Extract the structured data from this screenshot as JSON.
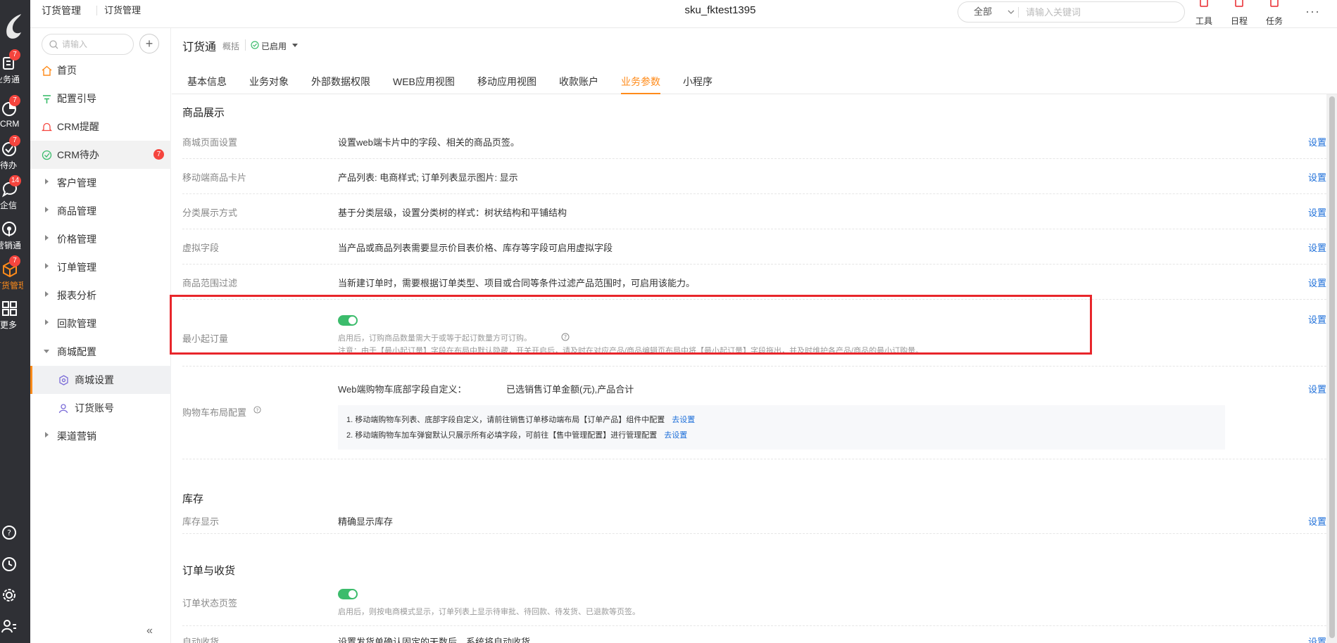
{
  "rail": {
    "items": [
      {
        "label": "业务通",
        "badge": "7"
      },
      {
        "label": "CRM",
        "badge": "7"
      },
      {
        "label": "待办",
        "badge": "7"
      },
      {
        "label": "企信",
        "badge": "14"
      },
      {
        "label": "营销通",
        "badge": ""
      },
      {
        "label": "订货管理",
        "badge": "7"
      },
      {
        "label": "更多",
        "badge": ""
      }
    ]
  },
  "header": {
    "breadcrumb_1": "订货管理",
    "breadcrumb_2": "订货管理",
    "title": "sku_fktest1395",
    "search_scope": "全部",
    "search_placeholder": "请输入关键词",
    "tools": [
      "工具",
      "日程",
      "任务"
    ],
    "more": "···"
  },
  "nav": {
    "search_placeholder": "请输入",
    "add": "+",
    "items": [
      {
        "label": "首页"
      },
      {
        "label": "配置引导"
      },
      {
        "label": "CRM提醒"
      },
      {
        "label": "CRM待办",
        "badge": "7"
      },
      {
        "label": "客户管理"
      },
      {
        "label": "商品管理"
      },
      {
        "label": "价格管理"
      },
      {
        "label": "订单管理"
      },
      {
        "label": "报表分析"
      },
      {
        "label": "回款管理"
      },
      {
        "label": "商城配置"
      },
      {
        "label": "商城设置"
      },
      {
        "label": "订货账号"
      },
      {
        "label": "渠道营销"
      }
    ],
    "collapse": "«"
  },
  "main": {
    "app_name": "订货通",
    "app_tag": "概括",
    "status": "已启用",
    "tabs": [
      "基本信息",
      "业务对象",
      "外部数据权限",
      "WEB应用视图",
      "移动应用视图",
      "收款账户",
      "业务参数",
      "小程序"
    ],
    "active_tab": "业务参数",
    "set_label": "设置",
    "sections": {
      "product": "商品展示",
      "stock": "库存",
      "order": "订单与收货"
    },
    "rows": {
      "r1": {
        "label": "商城页面设置",
        "desc": "设置web端卡片中的字段、相关的商品页签。"
      },
      "r2": {
        "label": "移动端商品卡片",
        "desc": "产品列表: 电商样式; 订单列表显示图片: 显示"
      },
      "r3": {
        "label": "分类展示方式",
        "desc": "基于分类层级，设置分类树的样式：树状结构和平铺结构"
      },
      "r4": {
        "label": "虚拟字段",
        "desc": "当产品或商品列表需要显示价目表价格、库存等字段可启用虚拟字段"
      },
      "r5": {
        "label": "商品范围过滤",
        "desc": "当新建订单时，需要根据订单类型、项目或合同等条件过滤产品范围时，可启用该能力。"
      },
      "r6": {
        "label": "最小起订量",
        "hint1": "启用后，订购商品数量需大于或等于起订数量方可订购。",
        "hint2": "注意：由于【最小起订量】字段在布局中默认隐藏，开关开启后，请及时在对应产品/商品编辑页布局中将【最小起订量】字段拖出，并及时维护各产品/商品的最小订购量。"
      },
      "r7": {
        "label": "购物车布局配置",
        "desc_label": "Web端购物车底部字段自定义：",
        "desc_value": "已选销售订单金额(元),产品合计",
        "line1": "1. 移动端购物车列表、底部字段自定义，请前往销售订单移动端布局【订单产品】组件中配置",
        "line2": "2. 移动端购物车加车弹窗默认只展示所有必填字段，可前往【售中管理配置】进行管理配置",
        "link": "去设置"
      },
      "r8": {
        "label": "库存显示",
        "desc": "精确显示库存"
      },
      "r9": {
        "label": "订单状态页签",
        "hint1": "启用后，则按电商模式显示，订单列表上显示待审批、待回款、待发货、已退款等页签。"
      },
      "r10": {
        "label": "自动收货",
        "desc": "设置发货单确认固定的天数后，系统将自动收货"
      }
    }
  },
  "colors": {
    "accent": "#ff8b1a",
    "link": "#1e6fd9",
    "switch_on": "#3cbc6c",
    "highlight": "#e8262b"
  }
}
